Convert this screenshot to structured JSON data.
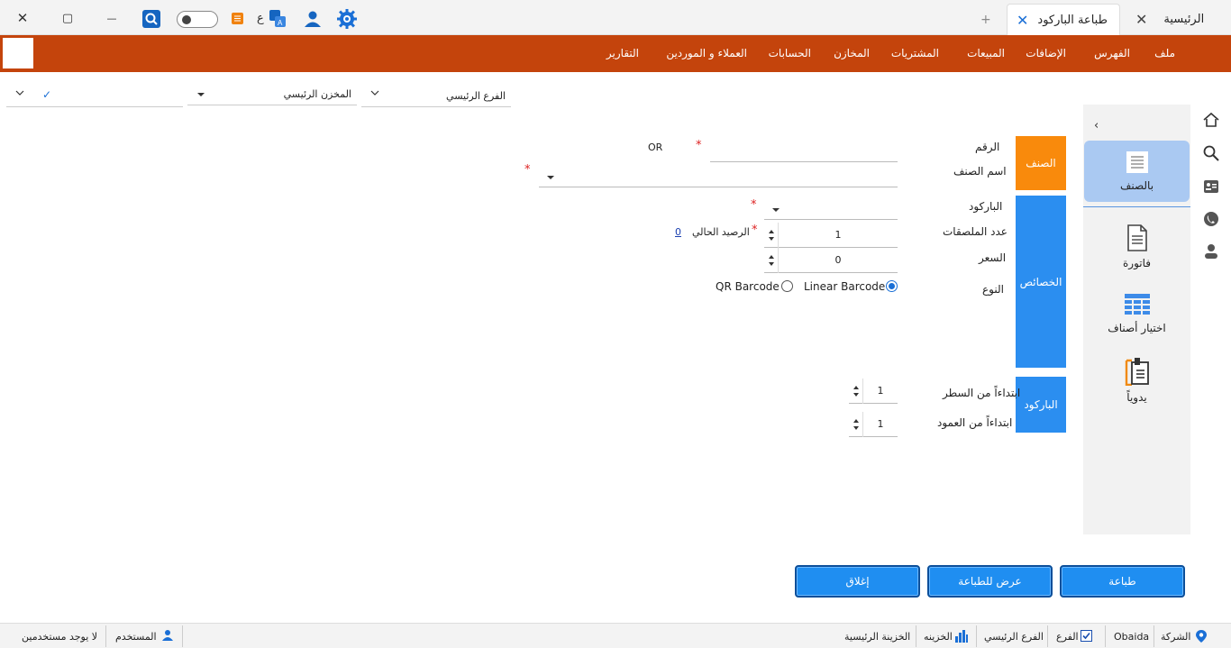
{
  "tabs": {
    "home": "الرئيسية",
    "barcode_print": "طباعة الباركود",
    "new_tab": "+"
  },
  "titlebar": {
    "lang_letter": "ع",
    "close_glyph": "✕",
    "max_glyph": "▢",
    "min_glyph": "—"
  },
  "menu": [
    "ملف",
    "الفهرس",
    "الإضافات",
    "المبيعات",
    "المشتريات",
    "المخازن",
    "الحسابات",
    "العملاء و الموردين",
    "التقارير"
  ],
  "filters": {
    "branch": "الفرع الرئيسي",
    "store": "المخزن الرئيسي",
    "check": "✓"
  },
  "panel_collapse": "‹",
  "modes": [
    {
      "label": "بالصنف",
      "icon": "document-lines-icon"
    },
    {
      "label": "فاتورة",
      "icon": "invoice-icon"
    },
    {
      "label": "اختيار أصناف",
      "icon": "grid-table-icon"
    },
    {
      "label": "يدوياً",
      "icon": "clipboard-icon"
    }
  ],
  "sections": {
    "item": "الصنف",
    "properties": "الخصائص",
    "barcode": "الباركود"
  },
  "fields": {
    "number_label": "الرقم",
    "or_label": "OR",
    "item_name_label": "اسم الصنف",
    "barcode_label": "الباركود",
    "labels_count_label": "عدد الملصقات",
    "labels_count_value": "1",
    "current_balance_label": "الرصيد الحالي",
    "current_balance_value": "0",
    "price_label": "السعر",
    "price_value": "0",
    "type_label": "النوع",
    "type_linear": "Linear Barcode",
    "type_qr": "QR Barcode",
    "start_row_label": "ابتداءاً من السطر",
    "start_row_value": "1",
    "start_col_label": "ابتداءاً من العمود",
    "start_col_value": "1",
    "required_mark": "*"
  },
  "buttons": {
    "print": "طباعة",
    "preview": "عرض للطباعة",
    "close": "إغلاق"
  },
  "status": {
    "company_label": "الشركة",
    "company_value": "Obaida",
    "branch_label": "الفرع",
    "branch_value": "الفرع الرئيسي",
    "treasury_label": "الخزينه",
    "treasury_value": "الخزينة الرئيسية",
    "user_label": "المستخدم",
    "user_value": "لا يوجد مستخدمين"
  },
  "colors": {
    "menu_bar": "#c4440c",
    "section_item": "#f98a0c",
    "section_blue": "#2b8ef0",
    "button_blue": "#1f8ef1",
    "active_mode": "#aac9f2"
  }
}
